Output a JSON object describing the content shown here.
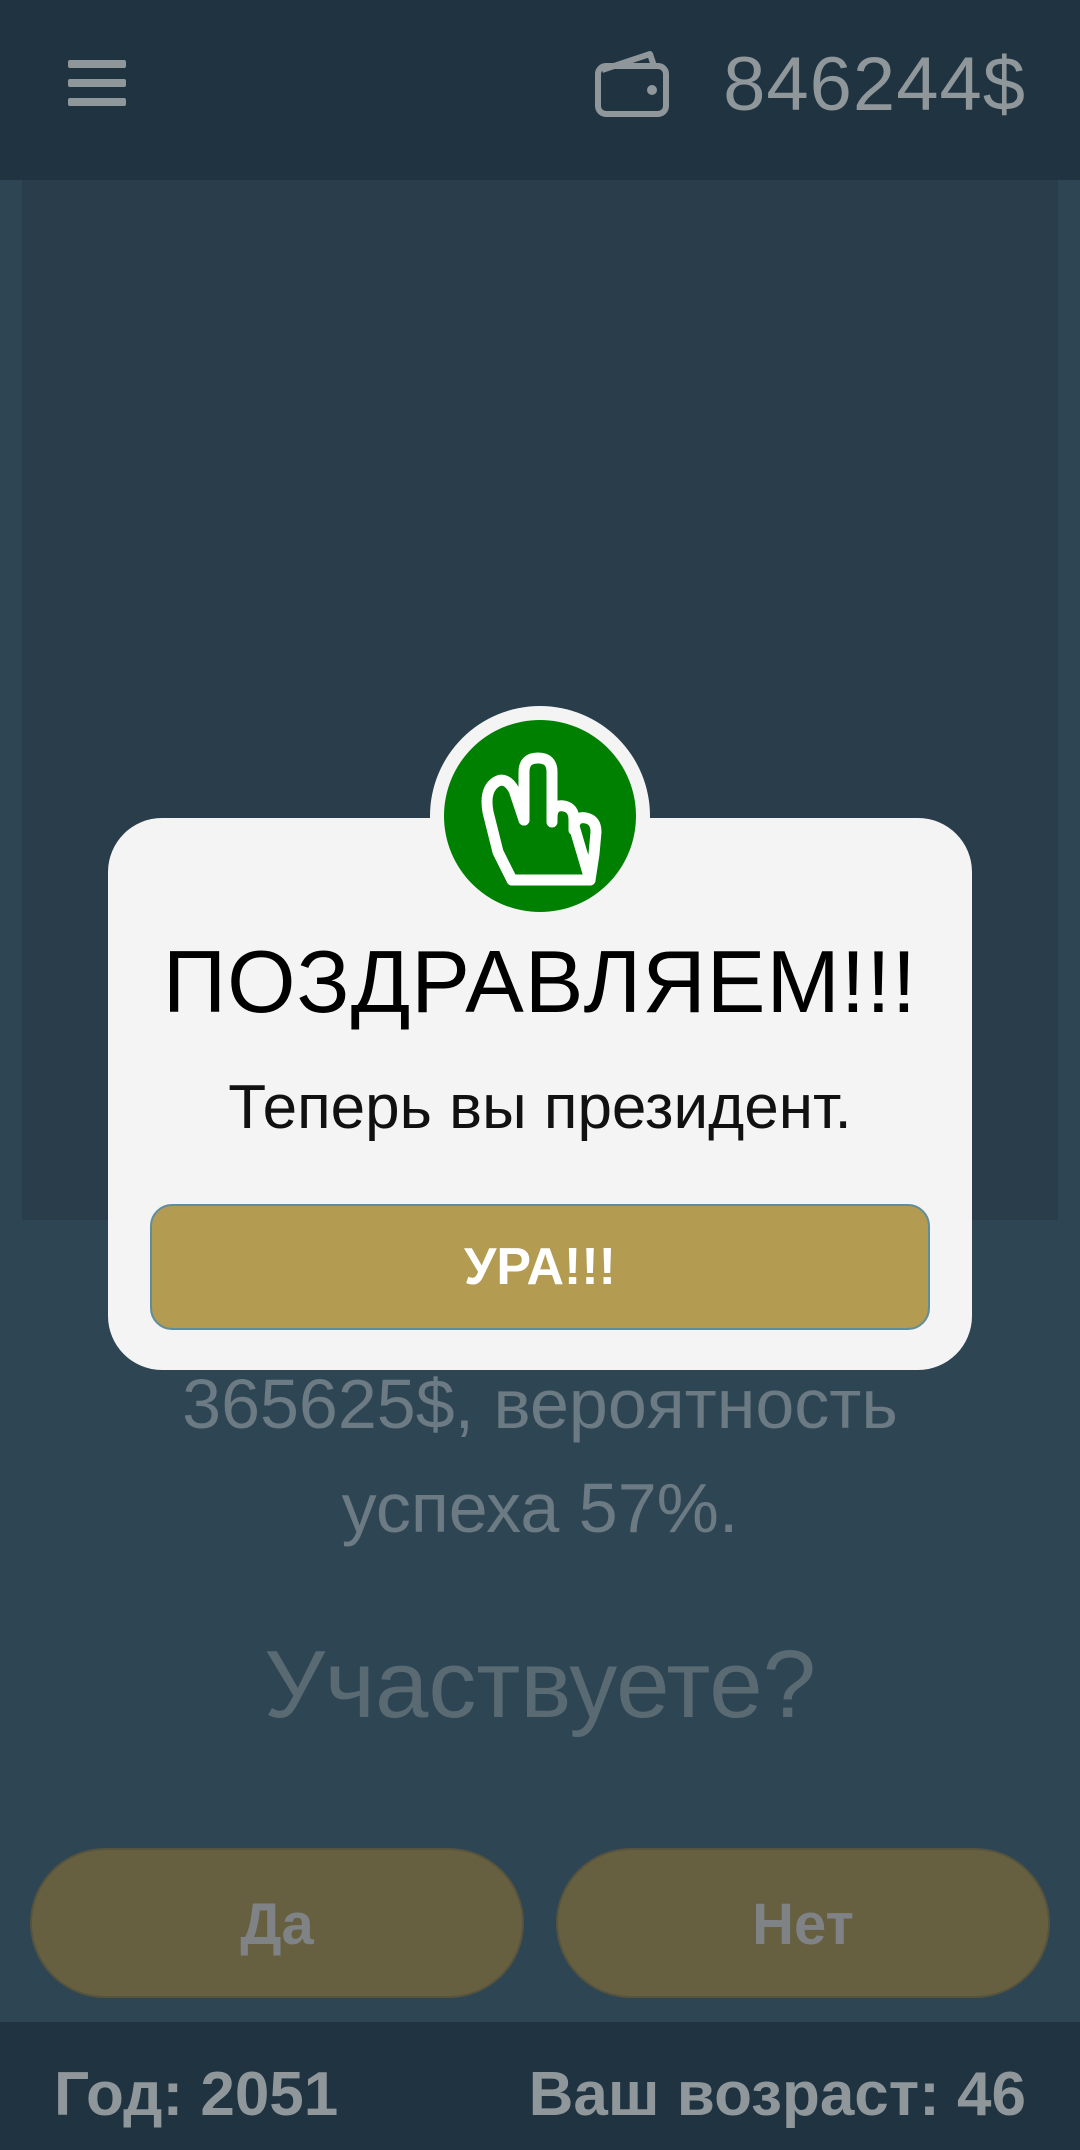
{
  "header": {
    "menu_icon": "hamburger-menu-icon",
    "wallet_icon": "wallet-icon",
    "balance": "846244$"
  },
  "offer": {
    "description_line_1": "365625$, вероятность",
    "description_line_2": "успеха 57%.",
    "question": "Участвуете?"
  },
  "actions": {
    "yes_label": "Да",
    "no_label": "Нет"
  },
  "footer": {
    "year": "Год: 2051",
    "age": "Ваш возраст: 46"
  },
  "modal": {
    "icon": "victory-hand-icon",
    "icon_color": "#008000",
    "title": "ПОЗДРАВЛЯЕМ!!!",
    "message": "Теперь вы президент.",
    "button_label": "УРА!!!",
    "button_color": "#b39b52"
  }
}
